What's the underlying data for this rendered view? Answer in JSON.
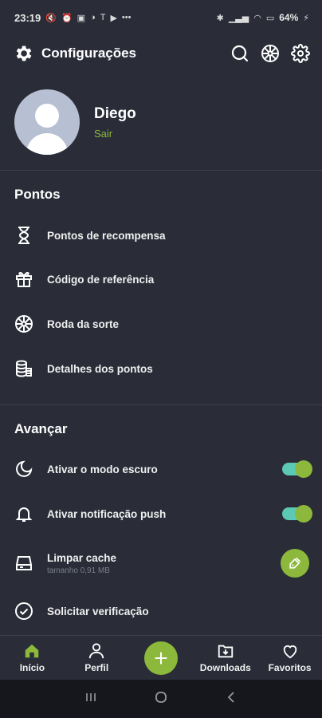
{
  "status": {
    "time": "23:19",
    "battery": "64%"
  },
  "header": {
    "title": "Configurações"
  },
  "profile": {
    "name": "Diego",
    "logout": "Sair"
  },
  "points": {
    "title": "Pontos",
    "items": [
      {
        "label": "Pontos de recompensa",
        "icon": "hourglass-icon"
      },
      {
        "label": "Código de referência",
        "icon": "gift-icon"
      },
      {
        "label": "Roda da sorte",
        "icon": "wheel-icon"
      },
      {
        "label": "Detalhes dos pontos",
        "icon": "coins-icon"
      }
    ]
  },
  "advanced": {
    "title": "Avançar",
    "dark_mode": "Ativar o modo escuro",
    "push": "Ativar notificação push",
    "cache": "Limpar cache",
    "cache_size": "tamanho 0,91 MB",
    "verify": "Solicitar verificação"
  },
  "nav": {
    "home": "Início",
    "profile": "Perfil",
    "downloads": "Downloads",
    "favorites": "Favoritos"
  },
  "colors": {
    "background": "#2a2d38",
    "accent": "#8cb93b",
    "toggle_track": "#5cc9b4"
  }
}
